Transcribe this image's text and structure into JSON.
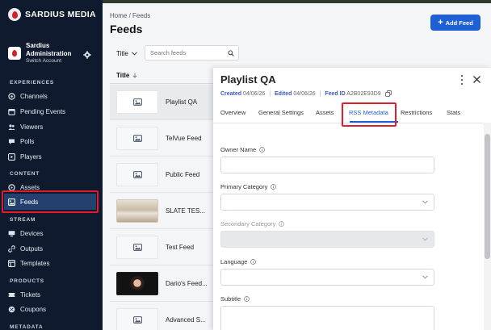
{
  "brand": {
    "name": "SARDIUS MEDIA"
  },
  "account": {
    "name": "Sardius Administration",
    "switch_label": "Switch Account"
  },
  "sidebar": {
    "sections": [
      {
        "title": "EXPERIENCES",
        "items": [
          {
            "label": "Channels",
            "icon": "channels-icon"
          },
          {
            "label": "Pending Events",
            "icon": "pending-events-icon"
          },
          {
            "label": "Viewers",
            "icon": "viewers-icon"
          },
          {
            "label": "Polls",
            "icon": "polls-icon"
          },
          {
            "label": "Players",
            "icon": "players-icon"
          }
        ]
      },
      {
        "title": "CONTENT",
        "items": [
          {
            "label": "Assets",
            "icon": "assets-icon"
          },
          {
            "label": "Feeds",
            "icon": "feeds-icon",
            "active": true
          }
        ]
      },
      {
        "title": "STREAM",
        "items": [
          {
            "label": "Devices",
            "icon": "devices-icon"
          },
          {
            "label": "Outputs",
            "icon": "outputs-icon"
          },
          {
            "label": "Templates",
            "icon": "templates-icon"
          }
        ]
      },
      {
        "title": "PRODUCTS",
        "items": [
          {
            "label": "Tickets",
            "icon": "tickets-icon"
          },
          {
            "label": "Coupons",
            "icon": "coupons-icon"
          }
        ]
      },
      {
        "title": "METADATA",
        "items": []
      }
    ]
  },
  "header": {
    "breadcrumb": "Home / Feeds",
    "title": "Feeds",
    "add_button": "Add Feed"
  },
  "filters": {
    "title_filter": "Title",
    "search_placeholder": "Search feeds"
  },
  "list": {
    "column_header": "Title",
    "rows": [
      {
        "title": "Playlist QA",
        "thumb": "placeholder",
        "selected": true
      },
      {
        "title": "TelVue Feed",
        "thumb": "placeholder"
      },
      {
        "title": "Public Feed",
        "thumb": "placeholder"
      },
      {
        "title": "SLATE TES...",
        "thumb": "photo-room"
      },
      {
        "title": "Test Feed",
        "thumb": "placeholder"
      },
      {
        "title": "Dario's Feed...",
        "thumb": "photo-person"
      },
      {
        "title": "Advanced S...",
        "thumb": "placeholder"
      }
    ]
  },
  "panel": {
    "title": "Playlist QA",
    "created_label": "Created",
    "created_value": "04/06/26",
    "edited_label": "Edited",
    "edited_value": "04/06/26",
    "feed_id_label": "Feed ID",
    "feed_id_value": "A2B02E93D9",
    "tabs": [
      "Overview",
      "General Settings",
      "Assets",
      "RSS Metadata",
      "Restrictions",
      "Stats"
    ],
    "active_tab": "RSS Metadata",
    "fields": [
      {
        "label": "Owner Name",
        "type": "text",
        "value": ""
      },
      {
        "label": "Primary Category",
        "type": "select",
        "value": ""
      },
      {
        "label": "Secondary Category",
        "type": "select",
        "value": "",
        "disabled": true
      },
      {
        "label": "Language",
        "type": "select",
        "value": ""
      },
      {
        "label": "Subtitle",
        "type": "text",
        "value": ""
      }
    ]
  },
  "colors": {
    "sidebar_bg": "#0f1a2e",
    "accent": "#1f5fd6",
    "highlight": "#e21c2b"
  }
}
